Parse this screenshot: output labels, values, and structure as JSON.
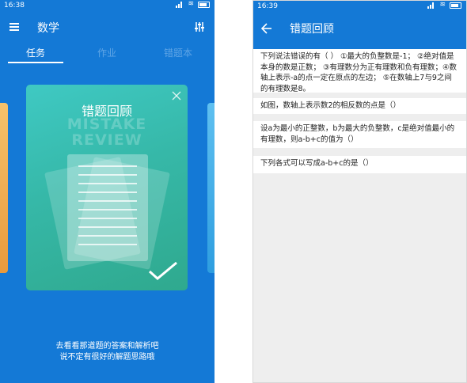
{
  "left_screen": {
    "status_time": "16:38",
    "subject_title": "数学",
    "tabs": [
      {
        "label": "任务",
        "active": true
      },
      {
        "label": "作业",
        "active": false
      },
      {
        "label": "错题本",
        "active": false
      }
    ],
    "card": {
      "title": "错题回顾",
      "watermark_line1": "MISTAKE",
      "watermark_line2": "REVIEW"
    },
    "caption_line1": "去看看那道题的答案和解析吧",
    "caption_line2": "说不定有很好的解题思路哦",
    "icons": [
      "menu-icon",
      "settings-icon",
      "close-icon",
      "checkmark-icon"
    ]
  },
  "right_screen": {
    "status_time": "16:39",
    "title": "错题回顾",
    "questions": [
      "下列说法错误的有（ ） ①最大的负整数是-1； ②绝对值是本身的数是正数； ③有理数分为正有理数和负有理数；④数轴上表示-a的点一定在原点的左边； ⑤在数轴上7与9之间的有理数是8。",
      "如图，数轴上表示数2的相反数的点是（）",
      "设a为最小的正整数，b为最大的负整数，c是绝对值最小的有理数，则a-b+c的值为（）",
      "下列各式可以写成a-b+c的是（）"
    ],
    "icons": [
      "back-arrow-icon"
    ]
  },
  "colors": {
    "primary_blue": "#1479d6",
    "card_teal": "#36b8a8",
    "background_gray": "#eeeeee"
  }
}
